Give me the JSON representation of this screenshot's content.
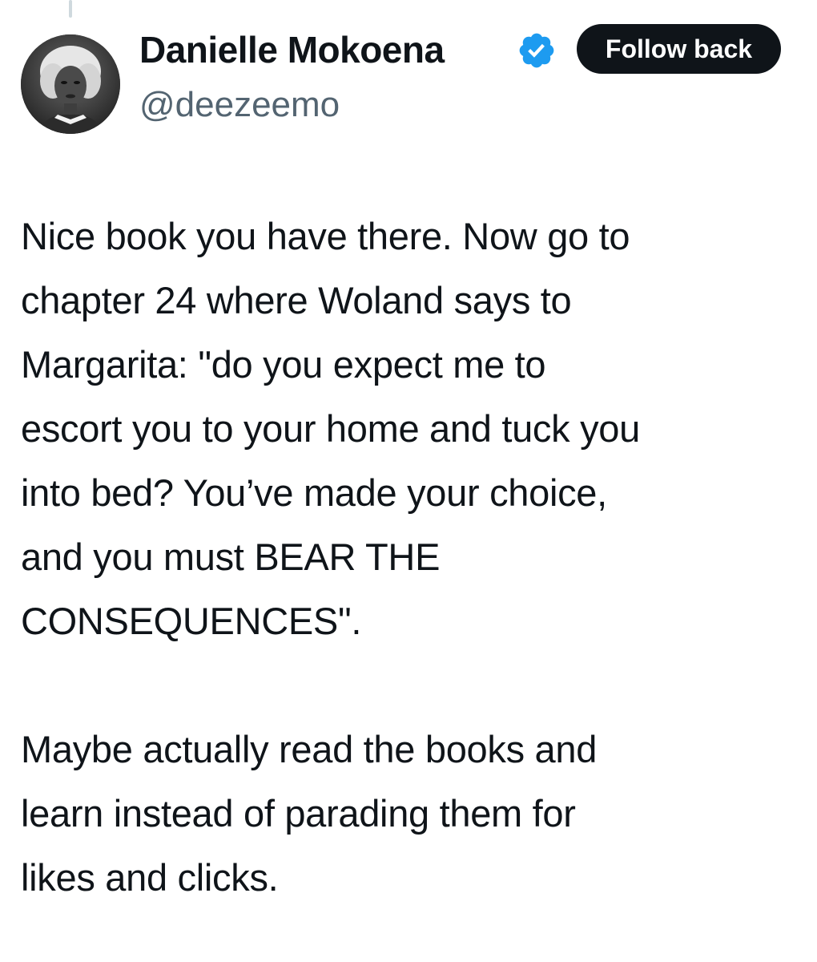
{
  "author": {
    "display_name": "Danielle Mokoena",
    "handle": "@deezeemo",
    "verified": true,
    "avatar_icon": "profile-photo",
    "verified_icon": "verified-badge-icon",
    "verified_color": "#1d9bf0"
  },
  "actions": {
    "follow_label": "Follow back"
  },
  "tweet": {
    "paragraph_1": "Nice book you have there. Now go to\nchapter 24 where Woland says to\nMargarita: \"do you expect me to\nescort you to your home and tuck you\ninto bed? You’ve made your choice,\nand you must BEAR THE\nCONSEQUENCES\".",
    "paragraph_2": "Maybe actually read the books and\nlearn instead of parading them for\nlikes and clicks."
  },
  "colors": {
    "text": "#0f1419",
    "secondary_text": "#536471",
    "button_bg": "#0f1419",
    "button_text": "#ffffff"
  }
}
